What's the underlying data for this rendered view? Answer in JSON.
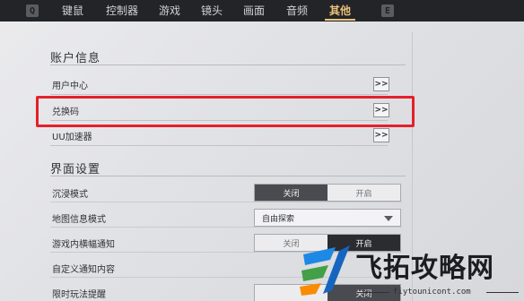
{
  "topbar": {
    "left_key": "Q",
    "right_key": "E",
    "tabs": [
      {
        "label": "键鼠"
      },
      {
        "label": "控制器"
      },
      {
        "label": "游戏"
      },
      {
        "label": "镜头"
      },
      {
        "label": "画面"
      },
      {
        "label": "音频"
      },
      {
        "label": "其他"
      }
    ],
    "active_tab": "其他"
  },
  "account": {
    "title": "账户信息",
    "items": [
      {
        "label": "用户中心",
        "button": ">>"
      },
      {
        "label": "兑换码",
        "button": ">>"
      },
      {
        "label": "UU加速器",
        "button": ">>"
      }
    ]
  },
  "interface": {
    "title": "界面设置",
    "immersive": {
      "label": "沉浸模式",
      "off": "关闭",
      "on": "开启",
      "selected": "关闭"
    },
    "map_info": {
      "label": "地图信息模式",
      "value": "自由探索"
    },
    "banner": {
      "label": "游戏内横幅通知",
      "off": "关闭",
      "on": "开启",
      "selected": "开启"
    },
    "custom_notice": {
      "label": "自定义通知内容"
    },
    "limited_time": {
      "label": "限时玩法提醒",
      "off": "关闭"
    }
  },
  "watermark": {
    "text": "飞拓攻略网",
    "url": "fiytounicont.com"
  }
}
